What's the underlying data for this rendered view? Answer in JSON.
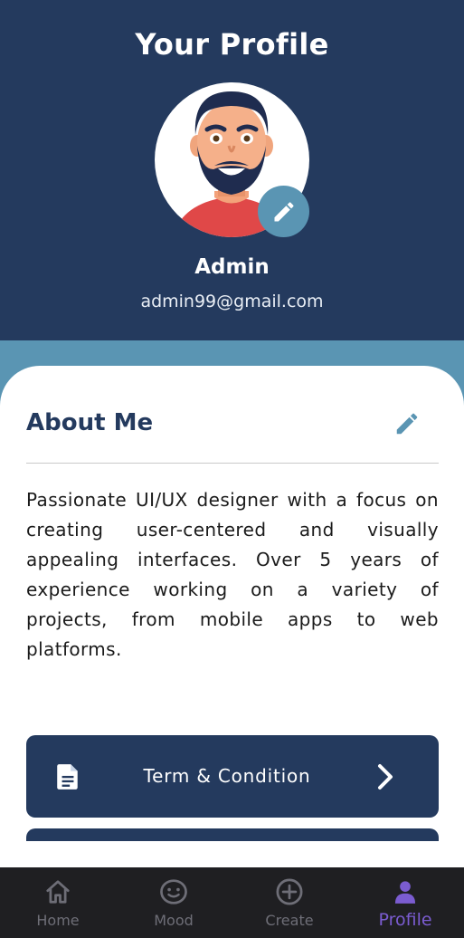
{
  "header": {
    "title": "Your Profile",
    "user_name": "Admin",
    "user_email": "admin99@gmail.com"
  },
  "about": {
    "title": "About Me",
    "text": "Passionate UI/UX designer with a focus on creating user-centered and visually appealing interfaces. Over 5 years of experience working on a variety of projects, from mobile apps to web platforms."
  },
  "menu": {
    "terms_label": "Term & Condition"
  },
  "tabs": [
    {
      "label": "Home",
      "icon": "home-icon"
    },
    {
      "label": "Mood",
      "icon": "mood-face-icon"
    },
    {
      "label": "Create",
      "icon": "plus-circle-icon"
    },
    {
      "label": "Profile",
      "icon": "person-icon"
    }
  ],
  "active_tab": "Profile",
  "colors": {
    "navy": "#243a5e",
    "accent_blue": "#5a95b3",
    "active_tab": "#7b5cd1",
    "tabbar_bg": "#1f1f22"
  }
}
